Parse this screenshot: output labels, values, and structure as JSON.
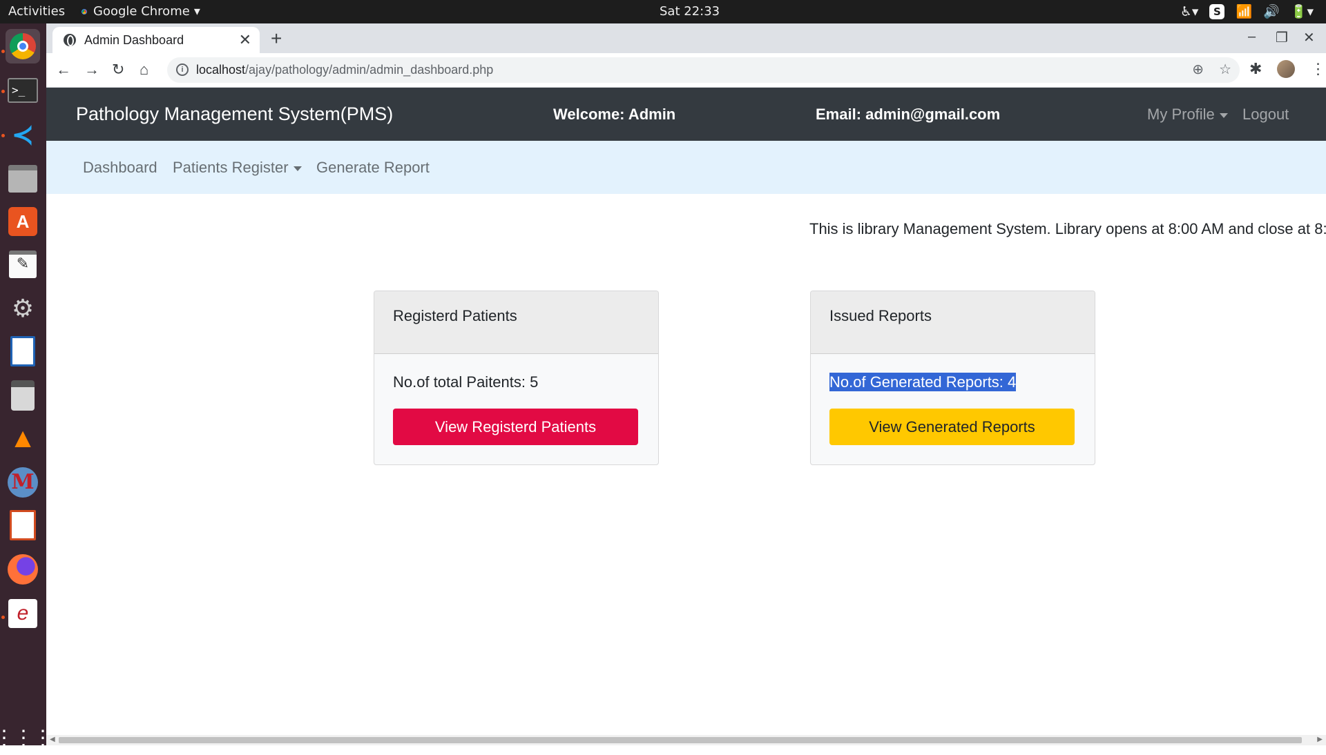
{
  "os": {
    "activities": "Activities",
    "app_name": "Google Chrome",
    "clock": "Sat 22:33"
  },
  "browser": {
    "tab_title": "Admin Dashboard",
    "url_host": "localhost",
    "url_path": "/ajay/pathology/admin/admin_dashboard.php"
  },
  "header": {
    "brand": "Pathology Management System(PMS)",
    "welcome": "Welcome: Admin",
    "email": "Email: admin@gmail.com",
    "my_profile": "My Profile",
    "logout": "Logout"
  },
  "subnav": {
    "dashboard": "Dashboard",
    "patients_register": "Patients Register",
    "generate_report": "Generate Report"
  },
  "marquee": "This is library Management System. Library opens at 8:00 AM and close at 8:",
  "cards": [
    {
      "header": "Registerd Patients",
      "text": "No.of total Paitents: 5",
      "button": "View Registerd Patients",
      "color": "#e20a44"
    },
    {
      "header": "Issued Reports",
      "text": "No.of Generated Reports: 4",
      "button": "View Generated Reports",
      "color": "#ffc800"
    }
  ],
  "dock_icons": [
    "chrome-icon",
    "terminal-icon",
    "vscode-icon",
    "files-icon",
    "software-icon",
    "text-editor-icon",
    "settings-icon",
    "writer-icon",
    "calculator-icon",
    "vlc-icon",
    "mysql-icon",
    "impress-icon",
    "firefox-icon",
    "eclipse-icon",
    "app-grid-icon"
  ],
  "selection_color": "#3367d6"
}
